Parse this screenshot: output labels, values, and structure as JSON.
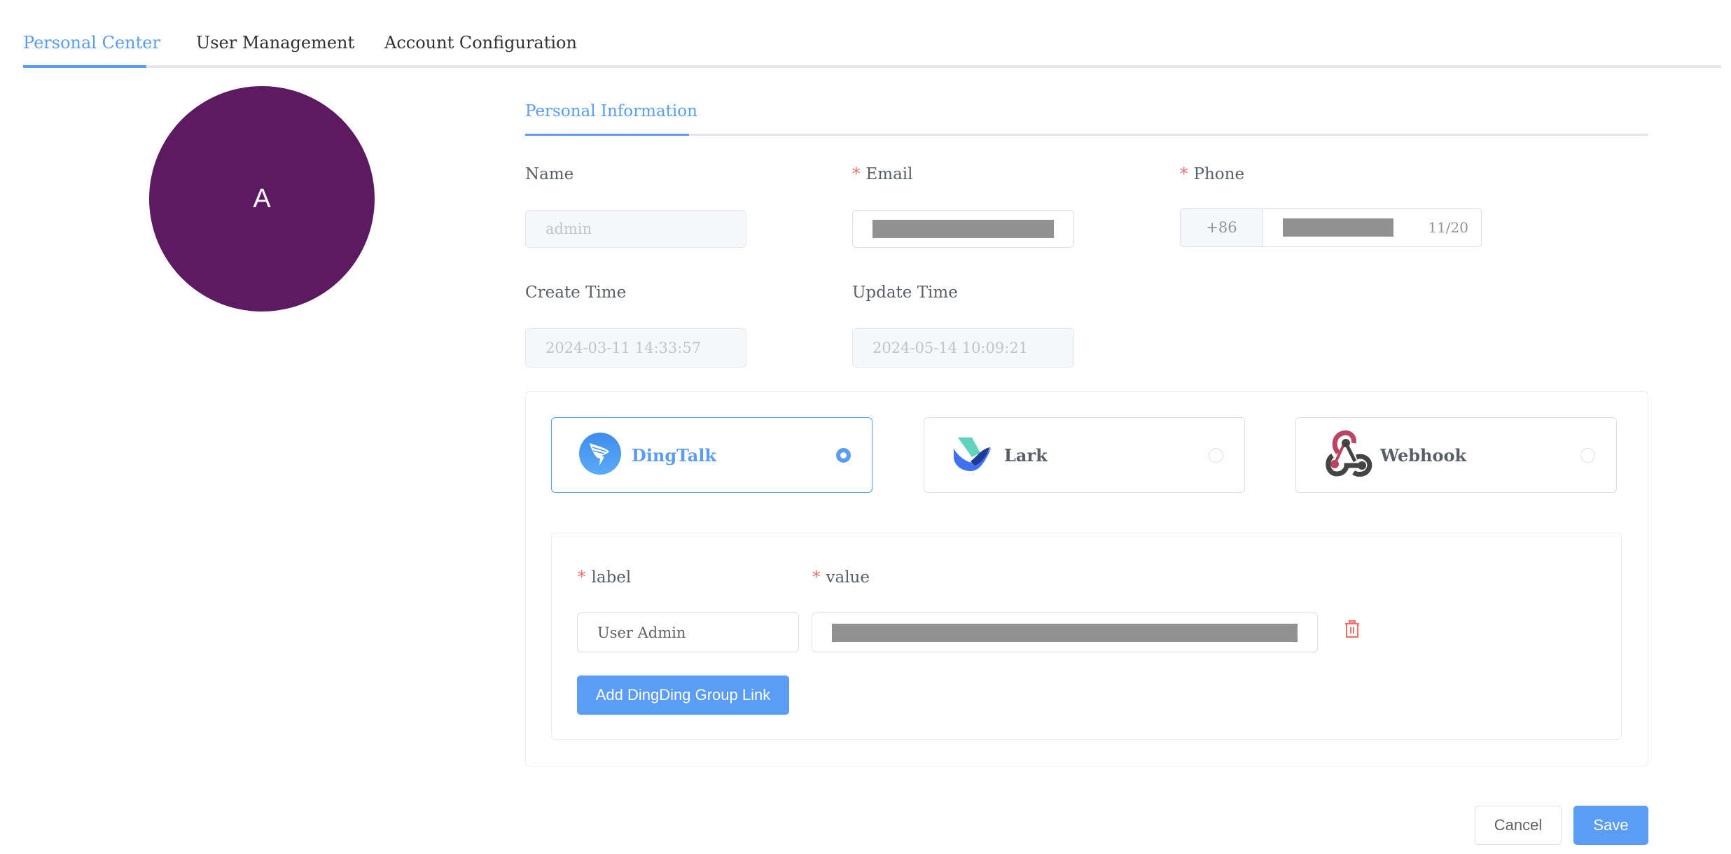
{
  "tabs": [
    {
      "label": "Personal Center",
      "active": true
    },
    {
      "label": "User Management",
      "active": false
    },
    {
      "label": "Account Configuration",
      "active": false
    }
  ],
  "avatar": {
    "initial": "A",
    "color": "#5c1a60"
  },
  "section": {
    "tab_label": "Personal Information"
  },
  "form": {
    "name": {
      "label": "Name",
      "value": "admin",
      "required": false,
      "disabled": true
    },
    "email": {
      "label": "Email",
      "value": "[redacted]",
      "required": true
    },
    "phone": {
      "label": "Phone",
      "prefix": "+86",
      "value": "[redacted]",
      "counter": "11/20",
      "required": true
    },
    "create_time": {
      "label": "Create Time",
      "value": "2024-03-11 14:33:57",
      "disabled": true
    },
    "update_time": {
      "label": "Update Time",
      "value": "2024-05-14 10:09:21",
      "disabled": true
    }
  },
  "channels": [
    {
      "name": "DingTalk",
      "icon": "dingtalk-icon",
      "selected": true
    },
    {
      "name": "Lark",
      "icon": "lark-icon",
      "selected": false
    },
    {
      "name": "Webhook",
      "icon": "webhook-icon",
      "selected": false
    }
  ],
  "links": {
    "label_header": "label",
    "value_header": "value",
    "rows": [
      {
        "label": "User Admin",
        "value": "[redacted]"
      }
    ],
    "add_button": "Add DingDing Group Link"
  },
  "footer": {
    "cancel_label": "Cancel",
    "save_label": "Save"
  },
  "colors": {
    "accent": "#5b9cf6",
    "danger": "#f56c6c",
    "avatar": "#5c1a60"
  }
}
